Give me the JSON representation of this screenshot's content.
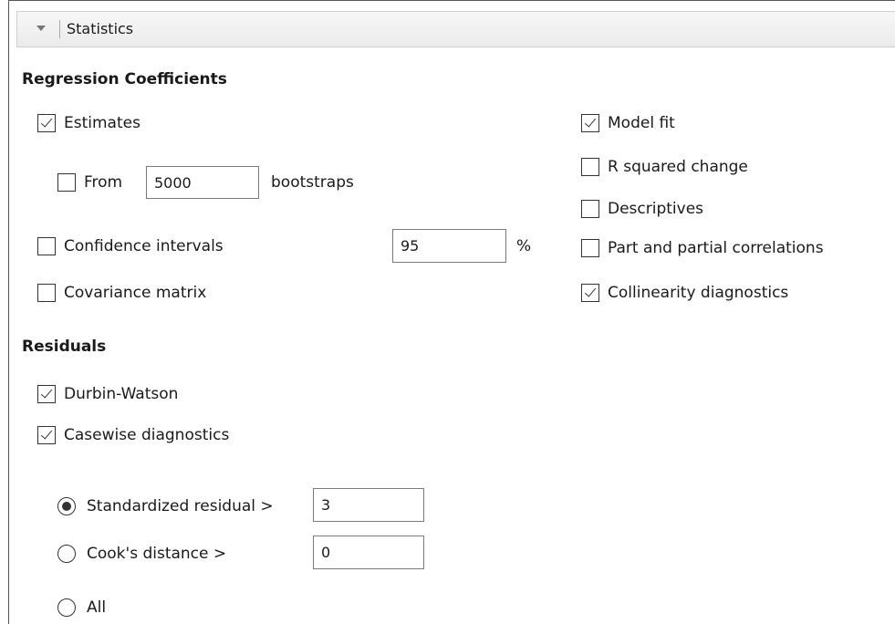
{
  "header": {
    "title": "Statistics"
  },
  "regression": {
    "heading": "Regression Coefficients",
    "estimates": {
      "label": "Estimates",
      "checked": true
    },
    "bootstrap": {
      "label": "From",
      "value": "5000",
      "suffix": "bootstraps",
      "checked": false
    },
    "confidence": {
      "label": "Confidence intervals",
      "value": "95",
      "suffix": "%",
      "checked": false
    },
    "covariance": {
      "label": "Covariance matrix",
      "checked": false
    },
    "model_fit": {
      "label": "Model fit",
      "checked": true
    },
    "r_squared": {
      "label": "R squared change",
      "checked": false
    },
    "descriptives": {
      "label": "Descriptives",
      "checked": false
    },
    "part_partial": {
      "label": "Part and partial correlations",
      "checked": false
    },
    "collinearity": {
      "label": "Collinearity diagnostics",
      "checked": true
    }
  },
  "residuals": {
    "heading": "Residuals",
    "durbin_watson": {
      "label": "Durbin-Watson",
      "checked": true
    },
    "casewise": {
      "label": "Casewise diagnostics",
      "checked": true
    },
    "standardized": {
      "label": "Standardized residual >",
      "value": "3",
      "selected": true
    },
    "cooks": {
      "label": "Cook's distance >",
      "value": "0",
      "selected": false
    },
    "all": {
      "label": "All",
      "selected": false
    }
  }
}
